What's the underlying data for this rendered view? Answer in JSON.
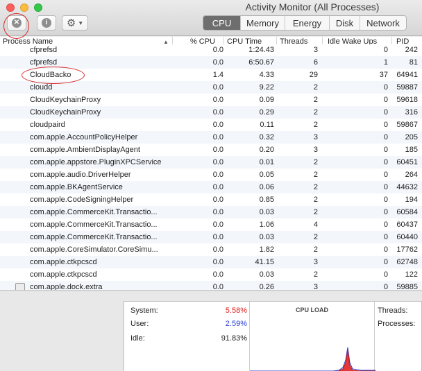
{
  "window": {
    "title": "Activity Monitor (All Processes)"
  },
  "toolbar": {
    "stop_icon": "x-circle-icon",
    "info_icon": "info-icon",
    "gear_icon": "gear-icon",
    "tabs": [
      {
        "label": "CPU",
        "active": true
      },
      {
        "label": "Memory",
        "active": false
      },
      {
        "label": "Energy",
        "active": false
      },
      {
        "label": "Disk",
        "active": false
      },
      {
        "label": "Network",
        "active": false
      }
    ]
  },
  "table": {
    "columns": {
      "name": "Process Name",
      "cpu": "% CPU",
      "cpu_time": "CPU Time",
      "threads": "Threads",
      "idle_wake_ups": "Idle Wake Ups",
      "pid": "PID"
    },
    "rows": [
      {
        "name": "cfprefsd",
        "cpu": "0.0",
        "cpu_time": "1:24.43",
        "threads": "3",
        "idle": "0",
        "pid": "242"
      },
      {
        "name": "cfprefsd",
        "cpu": "0.0",
        "cpu_time": "6:50.67",
        "threads": "6",
        "idle": "1",
        "pid": "81"
      },
      {
        "name": "CloudBacko",
        "cpu": "1.4",
        "cpu_time": "4.33",
        "threads": "29",
        "idle": "37",
        "pid": "64941"
      },
      {
        "name": "cloudd",
        "cpu": "0.0",
        "cpu_time": "9.22",
        "threads": "2",
        "idle": "0",
        "pid": "59887"
      },
      {
        "name": "CloudKeychainProxy",
        "cpu": "0.0",
        "cpu_time": "0.09",
        "threads": "2",
        "idle": "0",
        "pid": "59618"
      },
      {
        "name": "CloudKeychainProxy",
        "cpu": "0.0",
        "cpu_time": "0.29",
        "threads": "2",
        "idle": "0",
        "pid": "316"
      },
      {
        "name": "cloudpaird",
        "cpu": "0.0",
        "cpu_time": "0.11",
        "threads": "2",
        "idle": "0",
        "pid": "59867"
      },
      {
        "name": "com.apple.AccountPolicyHelper",
        "cpu": "0.0",
        "cpu_time": "0.32",
        "threads": "3",
        "idle": "0",
        "pid": "205"
      },
      {
        "name": "com.apple.AmbientDisplayAgent",
        "cpu": "0.0",
        "cpu_time": "0.20",
        "threads": "3",
        "idle": "0",
        "pid": "185"
      },
      {
        "name": "com.apple.appstore.PluginXPCService",
        "cpu": "0.0",
        "cpu_time": "0.01",
        "threads": "2",
        "idle": "0",
        "pid": "60451"
      },
      {
        "name": "com.apple.audio.DriverHelper",
        "cpu": "0.0",
        "cpu_time": "0.05",
        "threads": "2",
        "idle": "0",
        "pid": "264"
      },
      {
        "name": "com.apple.BKAgentService",
        "cpu": "0.0",
        "cpu_time": "0.06",
        "threads": "2",
        "idle": "0",
        "pid": "44632"
      },
      {
        "name": "com.apple.CodeSigningHelper",
        "cpu": "0.0",
        "cpu_time": "0.85",
        "threads": "2",
        "idle": "0",
        "pid": "194"
      },
      {
        "name": "com.apple.CommerceKit.Transactio...",
        "cpu": "0.0",
        "cpu_time": "0.03",
        "threads": "2",
        "idle": "0",
        "pid": "60584"
      },
      {
        "name": "com.apple.CommerceKit.Transactio...",
        "cpu": "0.0",
        "cpu_time": "1.06",
        "threads": "4",
        "idle": "0",
        "pid": "60437"
      },
      {
        "name": "com.apple.CommerceKit.Transactio...",
        "cpu": "0.0",
        "cpu_time": "0.03",
        "threads": "2",
        "idle": "0",
        "pid": "60440"
      },
      {
        "name": "com.apple.CoreSimulator.CoreSimu...",
        "cpu": "0.0",
        "cpu_time": "1.82",
        "threads": "2",
        "idle": "0",
        "pid": "17762"
      },
      {
        "name": "com.apple.ctkpcscd",
        "cpu": "0.0",
        "cpu_time": "41.15",
        "threads": "3",
        "idle": "0",
        "pid": "62748"
      },
      {
        "name": "com.apple.ctkpcscd",
        "cpu": "0.0",
        "cpu_time": "0.03",
        "threads": "2",
        "idle": "0",
        "pid": "122"
      },
      {
        "name": "com.apple.dock.extra",
        "cpu": "0.0",
        "cpu_time": "0.26",
        "threads": "3",
        "idle": "0",
        "pid": "59885"
      }
    ]
  },
  "summary": {
    "system_label": "System:",
    "system_value": "5.58%",
    "user_label": "User:",
    "user_value": "2.59%",
    "idle_label": "Idle:",
    "idle_value": "91.83%",
    "cpu_load_title": "CPU LOAD",
    "threads_label": "Threads:",
    "processes_label": "Processes:",
    "colors": {
      "system": "#e02020",
      "user": "#2a3fd6"
    }
  }
}
